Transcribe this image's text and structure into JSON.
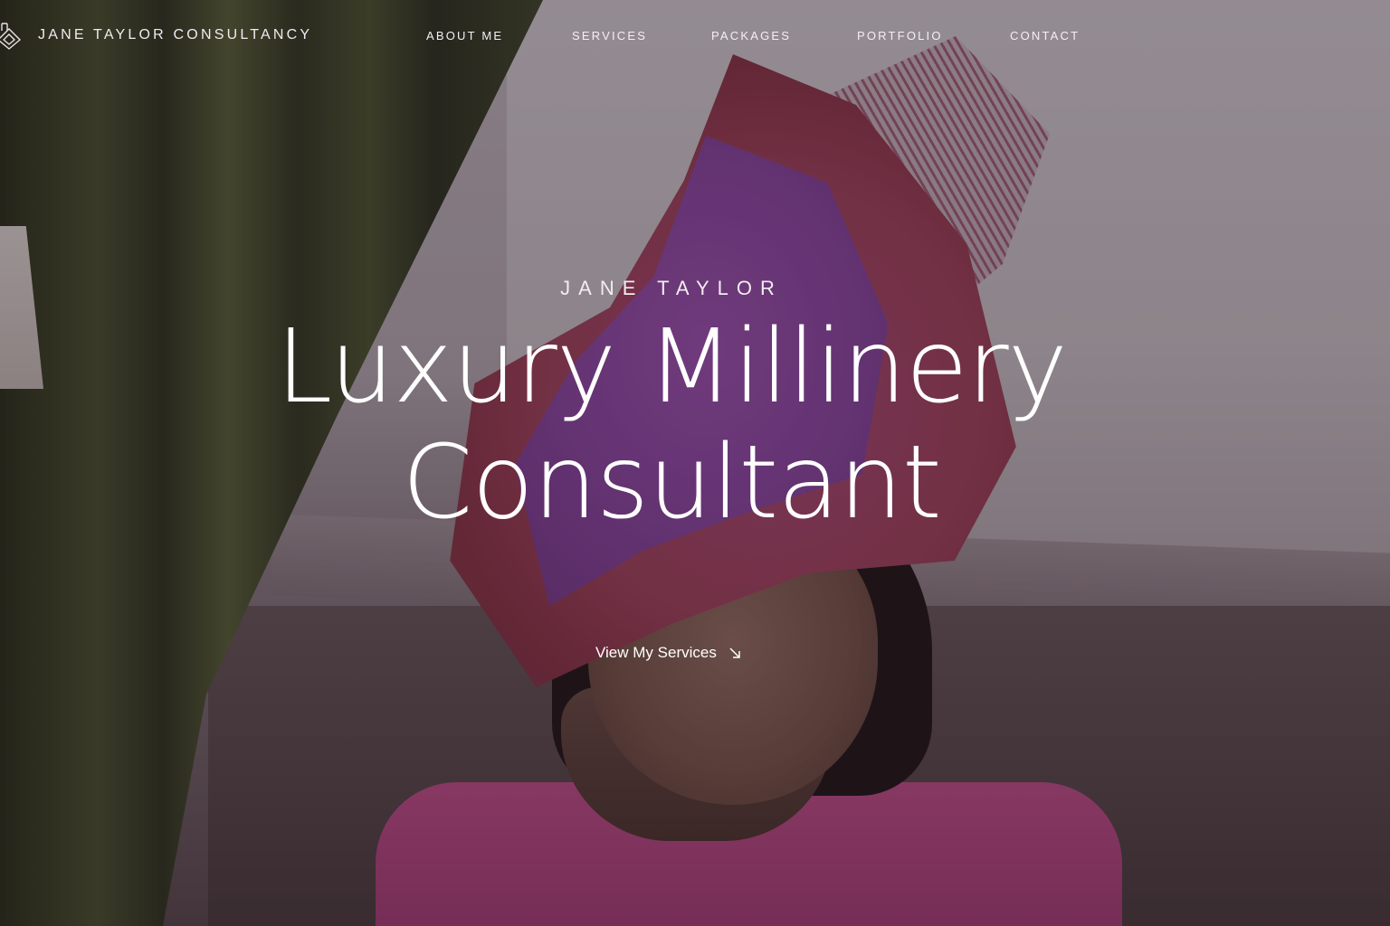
{
  "header": {
    "brand_name": "JANE TAYLOR CONSULTANCY",
    "logo_icon": "monogram-logo-icon"
  },
  "nav": {
    "items": [
      {
        "label": "ABOUT ME"
      },
      {
        "label": "SERVICES"
      },
      {
        "label": "PACKAGES"
      },
      {
        "label": "PORTFOLIO"
      },
      {
        "label": "CONTACT"
      }
    ]
  },
  "hero": {
    "eyebrow": "JANE TAYLOR",
    "headline_line1": "Luxury Millinery",
    "headline_line2": "Consultant",
    "cta_label": "View My Services",
    "cta_icon": "arrow-down-right-icon",
    "background": "woman-in-purple-red-hat-photo"
  },
  "colors": {
    "text": "#ffffff",
    "overlay": "#1e121a",
    "hat_purple": "#8f47a8",
    "hat_red": "#a8445f",
    "jacket_pink": "#c8508f",
    "curtain_green": "#4b5430"
  }
}
